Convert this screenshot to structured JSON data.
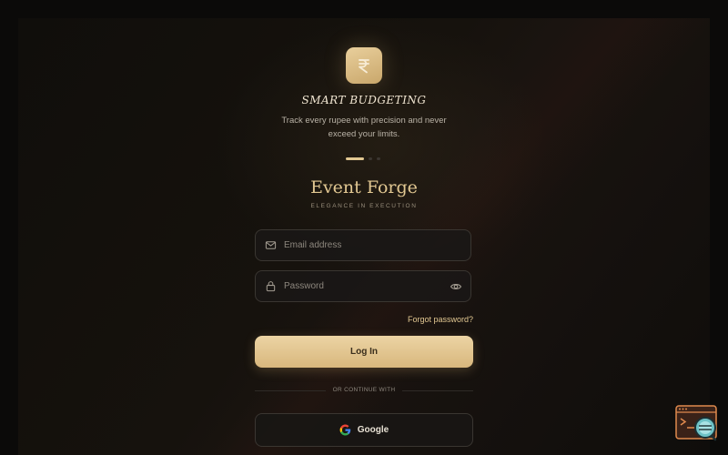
{
  "carousel": {
    "icon": "rupee-icon",
    "title": "SMART BUDGETING",
    "description": "Track every rupee with precision and never exceed your limits.",
    "slide_count": 3,
    "active_index": 0
  },
  "brand": {
    "name": "Event Forge",
    "tagline": "ELEGANCE IN EXECUTION"
  },
  "form": {
    "email": {
      "placeholder": "Email address",
      "value": "",
      "icon": "mail-icon"
    },
    "password": {
      "placeholder": "Password",
      "value": "",
      "icon": "lock-icon",
      "toggle_icon": "eye-icon"
    },
    "forgot_label": "Forgot password?",
    "login_label": "Log In",
    "divider_label": "OR CONTINUE WITH",
    "google_label": "Google"
  },
  "colors": {
    "accent_gold": "#e2c892",
    "background": "#0b0a09",
    "input_border": "#3a3631"
  }
}
